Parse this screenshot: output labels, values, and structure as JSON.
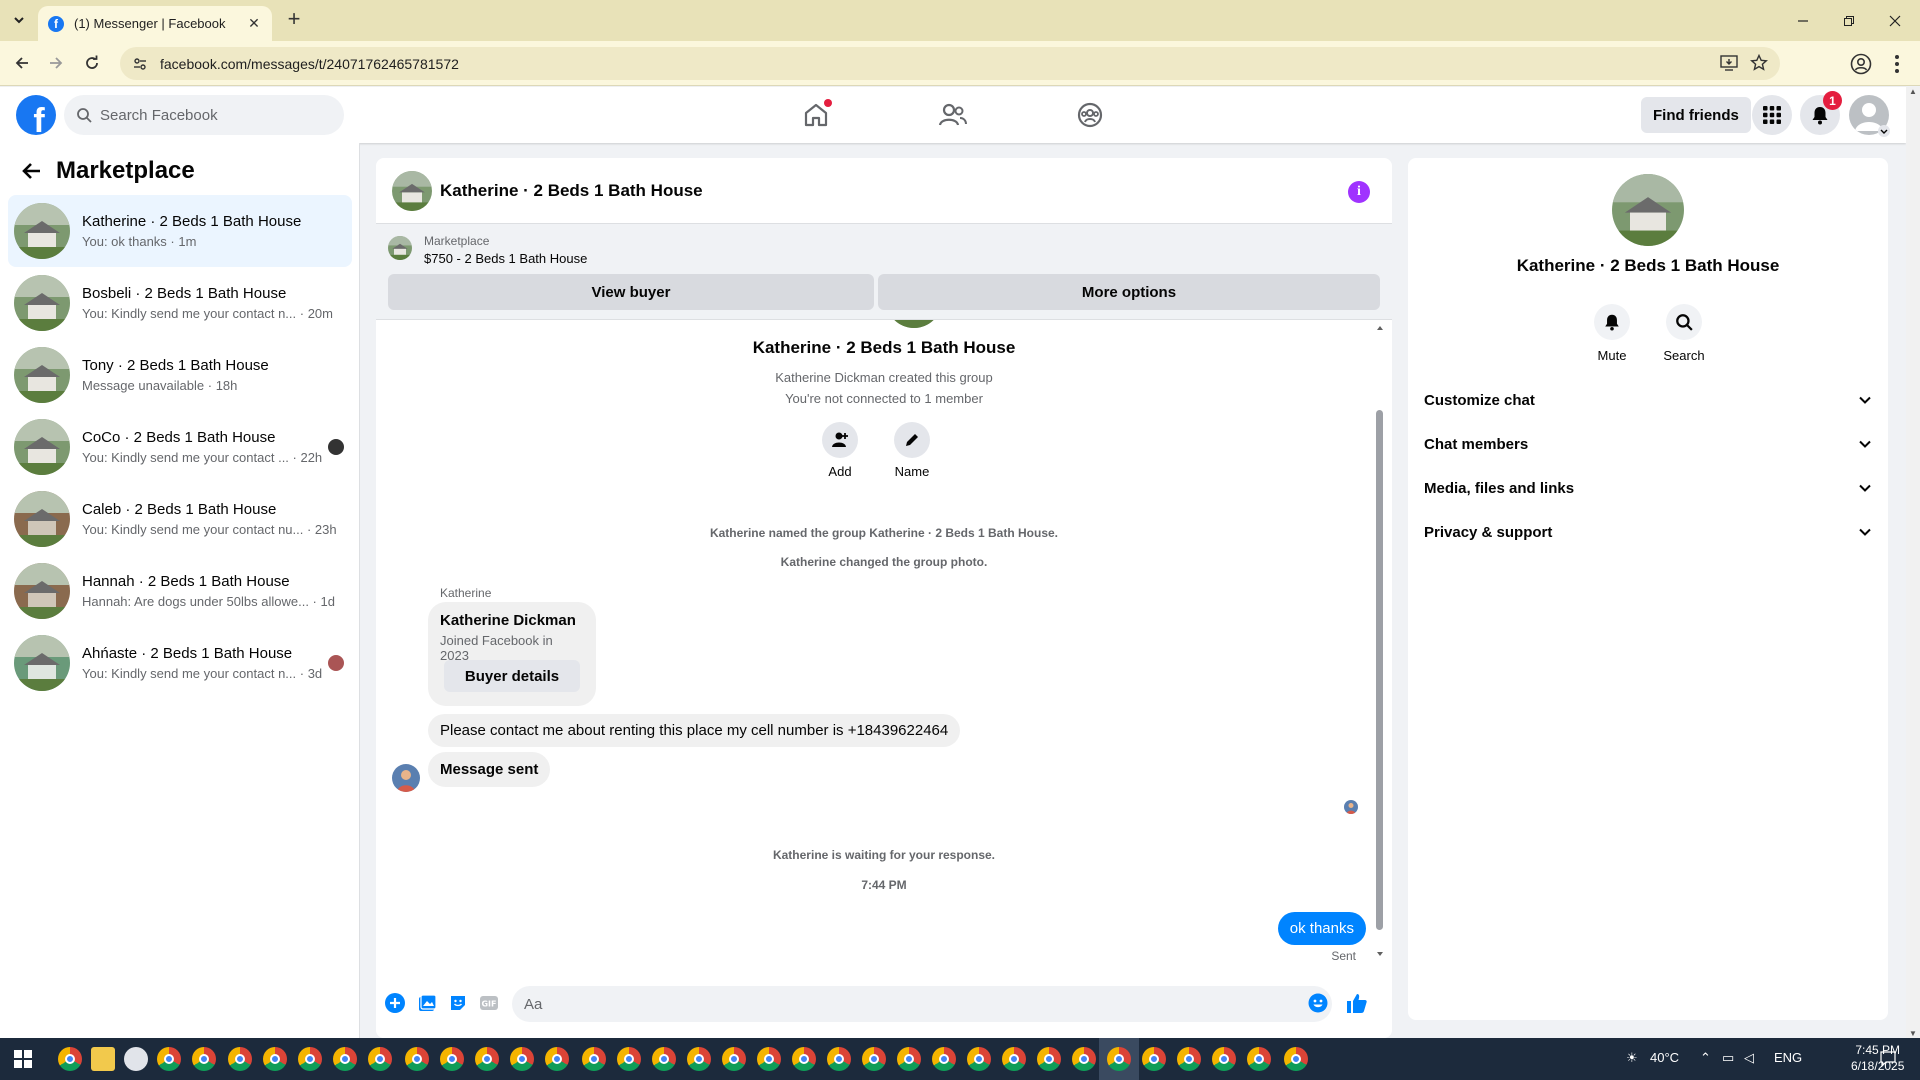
{
  "browser": {
    "tab_title": "(1) Messenger | Facebook",
    "url": "facebook.com/messages/t/24071762465781572"
  },
  "fbnav": {
    "search_placeholder": "Search Facebook",
    "find_friends": "Find friends",
    "notification_count": "1"
  },
  "sidebar": {
    "title": "Marketplace",
    "conversations": [
      {
        "name": "Katherine · 2 Beds 1 Bath House",
        "preview": "You: ok thanks · 1m",
        "active": true
      },
      {
        "name": "Bosbeli · 2 Beds 1 Bath House",
        "preview": "You: Kindly send me your contact n... · 20m"
      },
      {
        "name": "Tony · 2 Beds 1 Bath House",
        "preview": "Message unavailable · 18h"
      },
      {
        "name": "CoCo · 2 Beds 1 Bath House",
        "preview": "You: Kindly send me your contact ... · 22h"
      },
      {
        "name": "Caleb · 2 Beds 1 Bath House",
        "preview": "You: Kindly send me your contact nu... · 23h"
      },
      {
        "name": "Hannah · 2 Beds 1 Bath House",
        "preview": "Hannah: Are dogs under 50lbs allowe... · 1d"
      },
      {
        "name": "Ahńaste · 2 Beds 1 Bath House",
        "preview": "You: Kindly send me your contact n... · 3d"
      }
    ]
  },
  "chat": {
    "title": "Katherine · 2 Beds 1 Bath House",
    "marketplace_label": "Marketplace",
    "listing": "$750 - 2 Beds 1 Bath House",
    "view_buyer": "View buyer",
    "more_options": "More options",
    "group_name": "Katherine · 2 Beds 1 Bath House",
    "created_by": "Katherine Dickman created this group",
    "not_connected": "You're not connected to 1 member",
    "add_label": "Add",
    "name_label": "Name",
    "sys_named": "Katherine named the group Katherine · 2 Beds 1 Bath House.",
    "sys_photo": "Katherine changed the group photo.",
    "sender": "Katherine",
    "card_name": "Katherine Dickman",
    "card_joined": "Joined Facebook in 2023",
    "buyer_details": "Buyer details",
    "msg_contact": "Please contact me about renting this place my cell number is +18439622464",
    "msg_sent": "Message sent",
    "waiting": "Katherine is waiting for your response.",
    "time": "7:44 PM",
    "out_msg": "ok thanks",
    "sent_status": "Sent",
    "composer_placeholder": "Aa"
  },
  "right_panel": {
    "name": "Katherine · 2 Beds 1 Bath House",
    "mute": "Mute",
    "search": "Search",
    "sections": [
      "Customize chat",
      "Chat members",
      "Media, files and links",
      "Privacy & support"
    ]
  },
  "taskbar": {
    "weather": "40°C",
    "lang": "ENG",
    "time": "7:45 PM",
    "date": "6/18/2025"
  },
  "colors": {
    "fb_blue": "#1877f2",
    "messenger_blue": "#0084ff",
    "info_purple": "#a033ff",
    "tab_bar": "#e8e2b8"
  }
}
